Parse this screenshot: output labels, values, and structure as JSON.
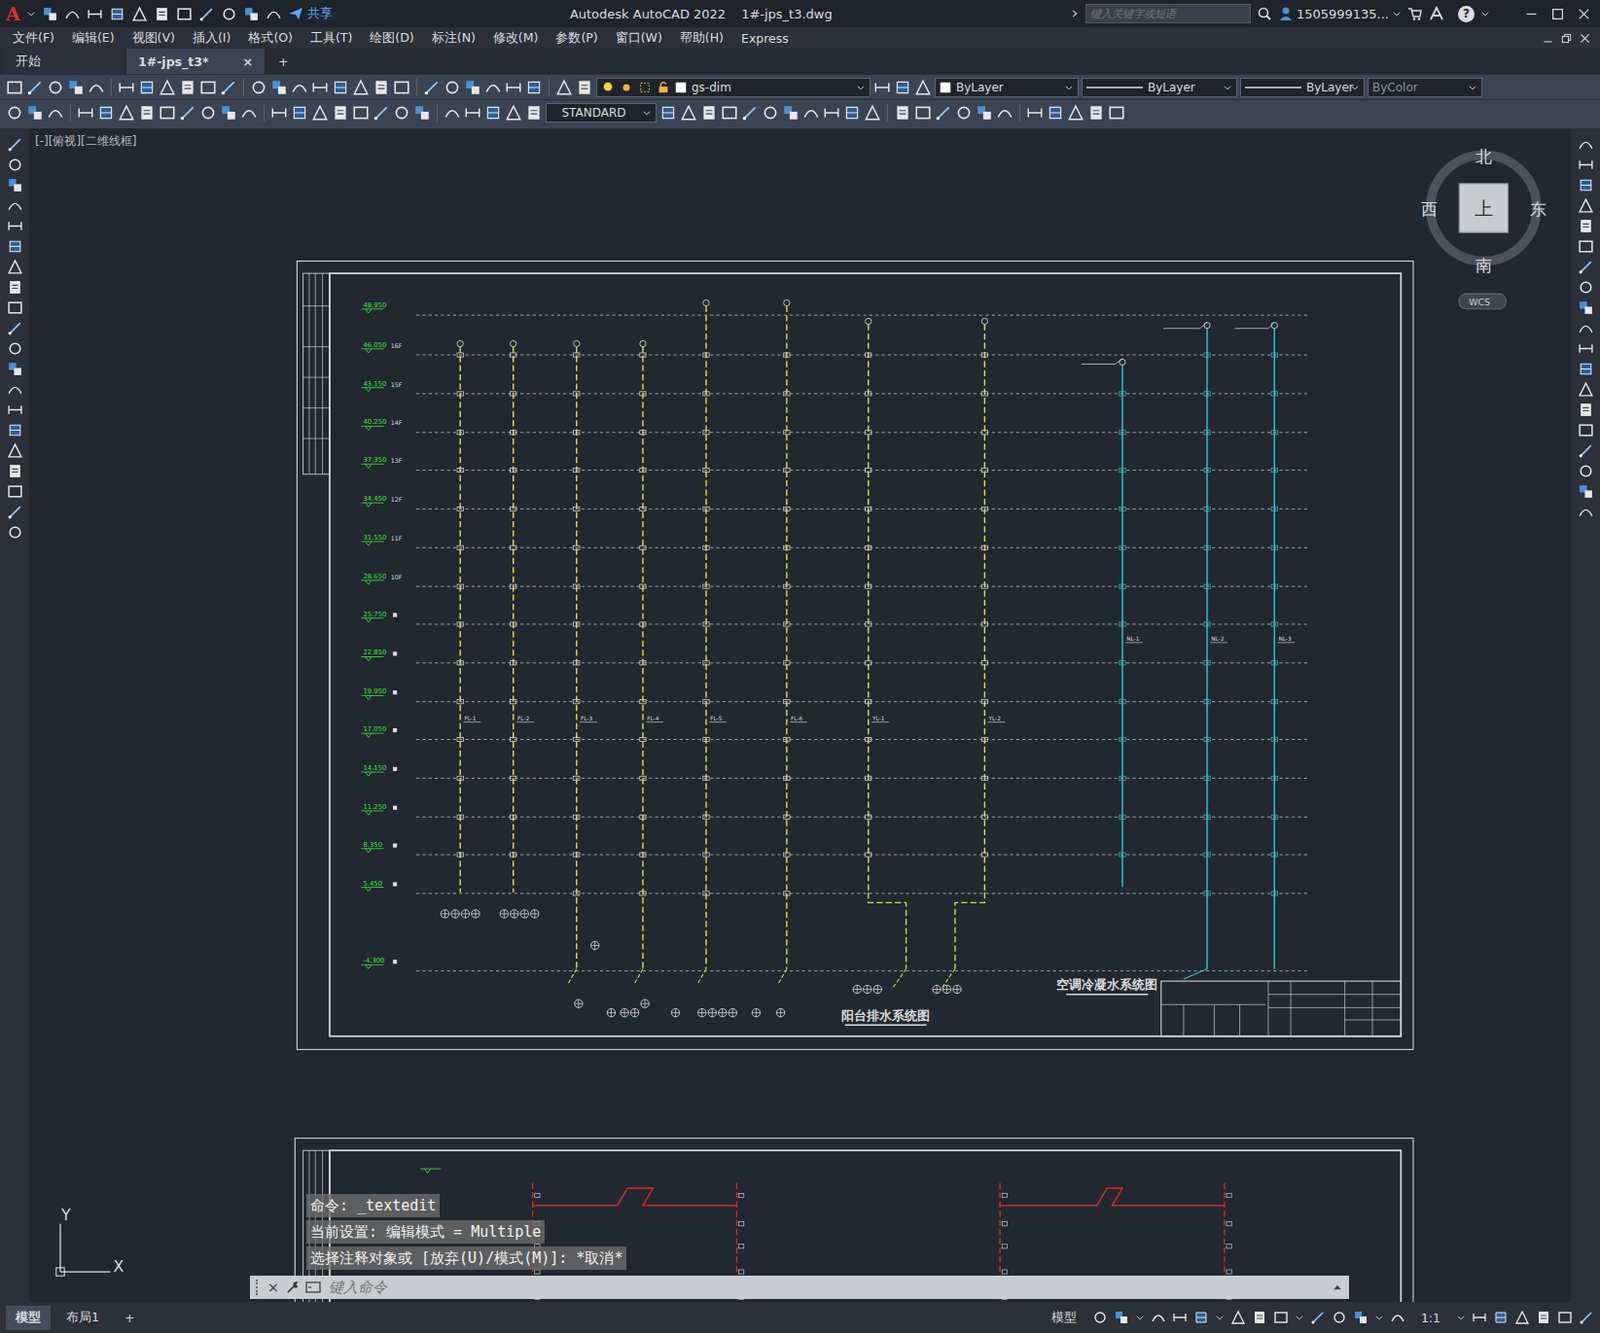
{
  "window": {
    "app_letter": "A",
    "title": "Autodesk AutoCAD 2022",
    "file": "1#-jps_t3.dwg",
    "share": "共享",
    "search_placeholder": "键入关键字或短语",
    "user": "1505999135...",
    "help": "?"
  },
  "menu": [
    "文件(F)",
    "编辑(E)",
    "视图(V)",
    "插入(I)",
    "格式(O)",
    "工具(T)",
    "绘图(D)",
    "标注(N)",
    "修改(M)",
    "参数(P)",
    "窗口(W)",
    "帮助(H)",
    "Express"
  ],
  "doc_tabs": [
    {
      "label": "开始",
      "selected": false
    },
    {
      "label": "1#-jps_t3*",
      "selected": true
    }
  ],
  "tab_close": "×",
  "tab_add": "+",
  "properties": {
    "layer": "gs-dim",
    "color": "ByLayer",
    "linetype": "ByLayer",
    "lineweight": "ByLayer",
    "plotstyle": "ByColor",
    "plotstyle_disabled": true,
    "text_style": "STANDARD"
  },
  "viewport": {
    "label": "[-][俯视][二维线框]"
  },
  "viewcube": {
    "north": "北",
    "south": "南",
    "east": "东",
    "west": "西",
    "face": "上",
    "ucs": "WCS"
  },
  "drawing": {
    "elevations": [
      "48.950",
      "46.050",
      "43.150",
      "40.250",
      "37.350",
      "34.450",
      "31.550",
      "28.650",
      "25.750",
      "22.850",
      "19.950",
      "17.050",
      "14.150",
      "11.250",
      "8.350",
      "5.450",
      "-4.300"
    ],
    "floors": [
      "16F",
      "15F",
      "14F",
      "13F",
      "12F",
      "11F",
      "10F"
    ],
    "pipes": [
      {
        "name": "FL-1",
        "color": "#d8d84a"
      },
      {
        "name": "FL-2",
        "color": "#d8d84a"
      },
      {
        "name": "FL-3",
        "color": "#d8d84a"
      },
      {
        "name": "FL-4",
        "color": "#d8d84a"
      },
      {
        "name": "FL-5",
        "color": "#d8d84a"
      },
      {
        "name": "FL-6",
        "color": "#d8d84a"
      },
      {
        "name": "YL-1",
        "color": "#d8d84a"
      },
      {
        "name": "YL-2",
        "color": "#d8d84a"
      },
      {
        "name": "NL-1",
        "color": "#2ec4c4"
      },
      {
        "name": "NL-2",
        "color": "#2ec4c4"
      },
      {
        "name": "NL-3",
        "color": "#2ec4c4"
      }
    ],
    "titles": [
      "阳台排水系统图",
      "空调冷凝水系统图"
    ]
  },
  "command": {
    "history": [
      "命令: _textedit",
      "当前设置: 编辑模式 = Multiple",
      "选择注释对象或 [放弃(U)/模式(M)]: *取消*"
    ],
    "placeholder": "键入命令",
    "close": "×"
  },
  "ucs_axes": {
    "x": "X",
    "y": "Y"
  },
  "layout_tabs": [
    {
      "label": "模型",
      "selected": true
    },
    {
      "label": "布局1",
      "selected": false
    }
  ],
  "layout_add": "+",
  "status": {
    "space": "模型",
    "scale": "1:1"
  }
}
